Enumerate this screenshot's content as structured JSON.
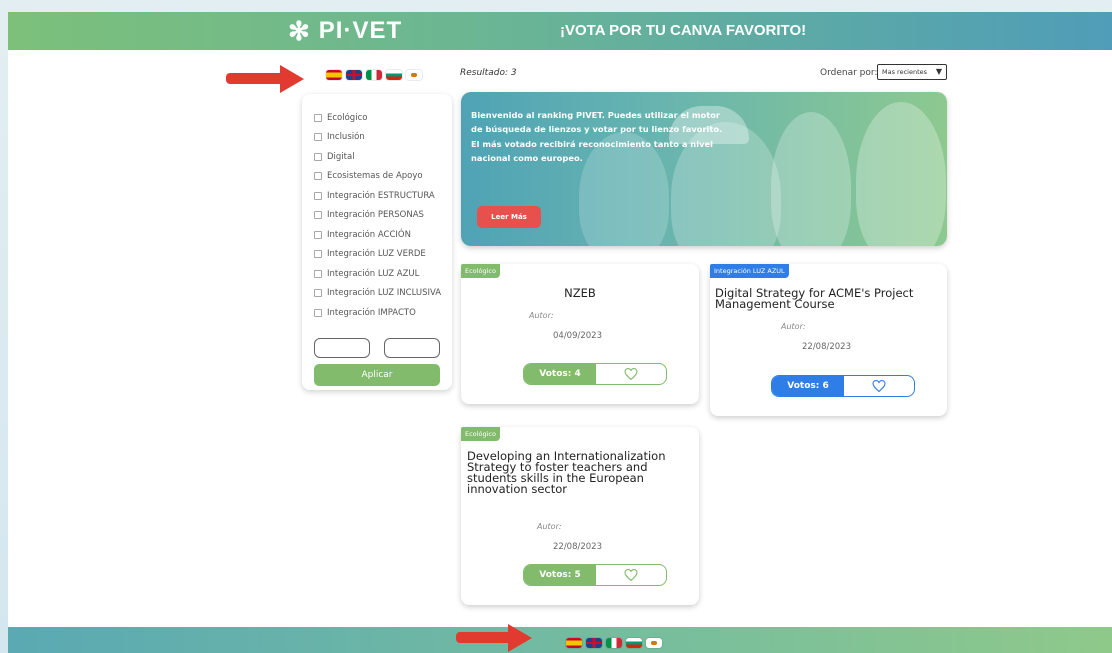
{
  "header": {
    "logo_text": "PI·VET",
    "logo_star": "✻",
    "title": "¡VOTA POR TU CANVA FAVORITO!"
  },
  "languages": [
    "es",
    "en",
    "it",
    "bg",
    "cy"
  ],
  "filters": {
    "items": [
      "Ecológico",
      "Inclusión",
      "Digital",
      "Ecosistemas de Apoyo",
      "Integración ESTRUCTURA",
      "Integración PERSONAS",
      "Integración ACCIÓN",
      "Integración LUZ VERDE",
      "Integración LUZ AZUL",
      "Integración LUZ INCLUSIVA",
      "Integración IMPACTO"
    ],
    "apply_label": "Aplicar"
  },
  "results": {
    "label": "Resultado: 3",
    "sort_label": "Ordenar por:",
    "sort_value": "Mas recientes"
  },
  "banner": {
    "text": "Bienvenido al ranking PIVET. Puedes utilizar el motor de búsqueda de lienzos y votar por tu lienzo favorito. El más votado recibirá reconocimiento tanto a nivel nacional como europeo.",
    "button_label": "Leer Más"
  },
  "cards": [
    {
      "tag": "Ecológico",
      "title": "NZEB",
      "author_label": "Autor:",
      "date": "04/09/2023",
      "votes_label": "Votos: 4"
    },
    {
      "tag": "Integración LUZ AZUL",
      "title": "Digital Strategy for ACME's Project Management Course",
      "author_label": "Autor:",
      "date": "22/08/2023",
      "votes_label": "Votos: 6"
    },
    {
      "tag": "Ecológico",
      "title": "Developing an Internationalization Strategy to foster teachers and students skills in the European innovation sector",
      "author_label": "Autor:",
      "date": "22/08/2023",
      "votes_label": "Votos: 5"
    }
  ],
  "colors": {
    "header_start": "#7cc07a",
    "header_end": "#4f9db8",
    "accent_green": "#82bb6c",
    "accent_blue": "#2f7ee8",
    "arrow_red": "#e03b2e",
    "banner_button": "#e8504d"
  }
}
